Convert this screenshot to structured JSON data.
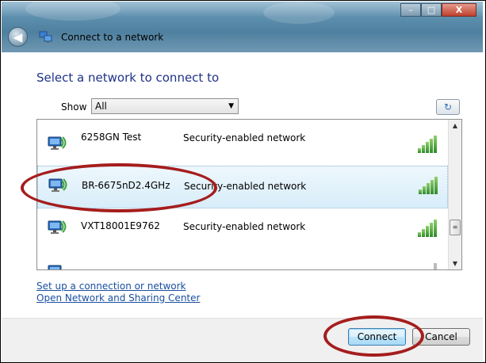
{
  "window": {
    "title": "Connect to a network",
    "back_glyph": "◀",
    "controls": {
      "minimize": "–",
      "maximize": "□",
      "close": "X"
    }
  },
  "main": {
    "heading": "Select a network to connect to",
    "show_label": "Show",
    "show_value": "All",
    "refresh_glyph": "↻"
  },
  "networks": [
    {
      "name": "6258GN Test",
      "security": "Security-enabled network",
      "signal_bars": 5,
      "selected": false
    },
    {
      "name": "BR-6675nD2.4GHz",
      "security": "Security-enabled network",
      "signal_bars": 5,
      "selected": true
    },
    {
      "name": "VXT18001E9762",
      "security": "Security-enabled network",
      "signal_bars": 5,
      "selected": false
    }
  ],
  "links": {
    "setup": "Set up a connection or network",
    "sharing_center": "Open Network and Sharing Center"
  },
  "buttons": {
    "connect": "Connect",
    "cancel": "Cancel"
  },
  "icons": [
    "back-arrow-icon",
    "network-small-icon",
    "wireless-network-icon",
    "signal-strength-icon",
    "refresh-icon",
    "dropdown-arrow-icon"
  ],
  "colors": {
    "heading": "#1e3287",
    "link": "#1a4fa0",
    "annotation": "#a51d1d",
    "signal": "#2f8a2a"
  }
}
